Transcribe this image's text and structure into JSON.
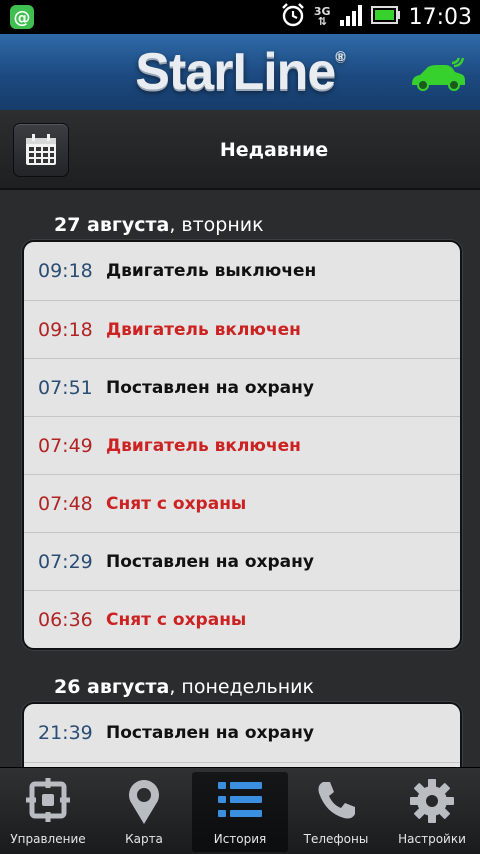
{
  "status_bar": {
    "time": "17:03",
    "network": "3G"
  },
  "header": {
    "brand": "StarLine",
    "brand_mark": "®"
  },
  "toolbar": {
    "title": "Недавние"
  },
  "days": [
    {
      "date": "27 августа",
      "weekday": ", вторник",
      "events": [
        {
          "time": "09:18",
          "text": "Двигатель выключен",
          "alert": false
        },
        {
          "time": "09:18",
          "text": "Двигатель включен",
          "alert": true
        },
        {
          "time": "07:51",
          "text": "Поставлен на охрану",
          "alert": false
        },
        {
          "time": "07:49",
          "text": "Двигатель включен",
          "alert": true
        },
        {
          "time": "07:48",
          "text": "Снят с охраны",
          "alert": true
        },
        {
          "time": "07:29",
          "text": "Поставлен на охрану",
          "alert": false
        },
        {
          "time": "06:36",
          "text": "Снят с охраны",
          "alert": true
        }
      ]
    },
    {
      "date": "26 августа",
      "weekday": ", понедельник",
      "events": [
        {
          "time": "21:39",
          "text": "Поставлен на охрану",
          "alert": false
        }
      ]
    }
  ],
  "nav": {
    "control": "Управление",
    "map": "Карта",
    "history": "История",
    "phones": "Телефоны",
    "settings": "Настройки"
  },
  "colors": {
    "alert": "#cc2222",
    "time_normal": "#2b4c73",
    "accent_green": "#37d12e"
  }
}
